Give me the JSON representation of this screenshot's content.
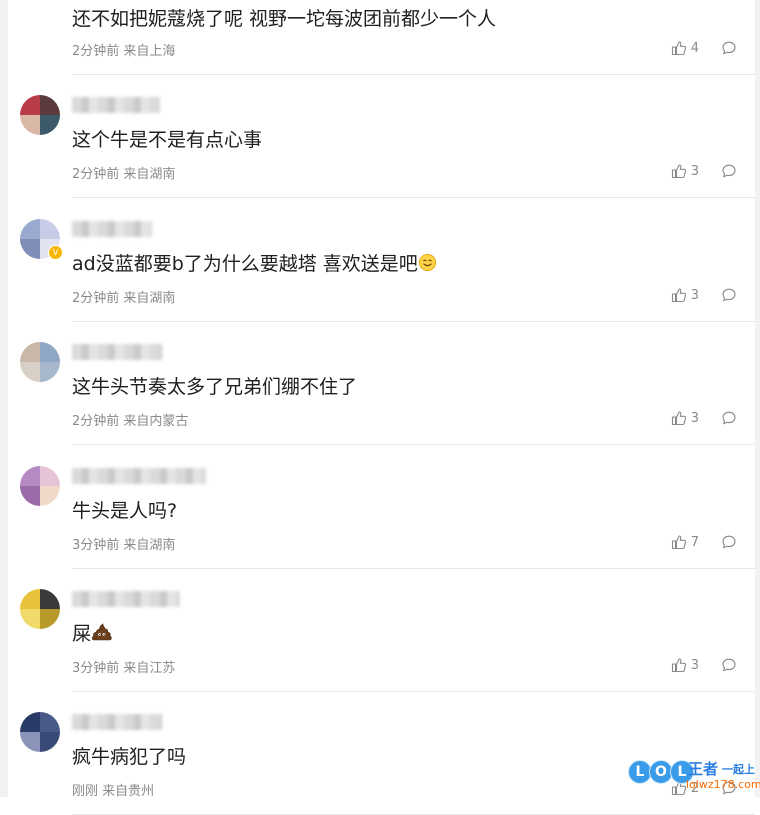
{
  "comments": [
    {
      "text": "还不如把妮蔻烧了呢 视野一坨每波团前都少一个人",
      "time": "2分钟前",
      "location": "来自上海",
      "likes": "4",
      "avatar_colors": [
        "#3a3a3a",
        "#6a6a6a",
        "#8a8a8a",
        "#4a4a4a"
      ]
    },
    {
      "text": "这个牛是不是有点心事",
      "time": "2分钟前",
      "location": "来自湖南",
      "likes": "3",
      "avatar_colors": [
        "#b83c4a",
        "#5a3a3a",
        "#d9b8a8",
        "#3c5a6a"
      ]
    },
    {
      "text": "ad没蓝都要b了为什么要越塔 喜欢送是吧",
      "emoji": "smile-emoji",
      "time": "2分钟前",
      "location": "来自湖南",
      "likes": "3",
      "avatar_colors": [
        "#9aa9cf",
        "#c7cde6",
        "#7f8db8",
        "#e1e4f0"
      ],
      "verified": true
    },
    {
      "text": "这牛头节奏太多了兄弟们绷不住了",
      "time": "2分钟前",
      "location": "来自内蒙古",
      "likes": "3",
      "avatar_colors": [
        "#c9b7a8",
        "#8fa6c4",
        "#d8cfc6",
        "#a8b8cc"
      ]
    },
    {
      "text": "牛头是人吗?",
      "time": "3分钟前",
      "location": "来自湖南",
      "likes": "7",
      "avatar_colors": [
        "#b58ac2",
        "#e6c4d8",
        "#9c6aa8",
        "#f0d9c8"
      ]
    },
    {
      "text": "屎",
      "emoji": "poop-emoji",
      "time": "3分钟前",
      "location": "来自江苏",
      "likes": "3",
      "avatar_colors": [
        "#e7c23a",
        "#3a3a3a",
        "#f1d96a",
        "#b89a2a"
      ]
    },
    {
      "text": "疯牛病犯了吗",
      "time": "刚刚",
      "location": "来自贵州",
      "likes": "2",
      "avatar_colors": [
        "#2a3a66",
        "#4a5a88",
        "#8a94b8",
        "#3a4a78"
      ]
    }
  ],
  "watermark": {
    "logo_text": "LOL",
    "brand": "王者",
    "slogan": "一起上",
    "url": "lolwz178.com"
  },
  "colors": {
    "text": "#202020",
    "meta": "#8a8a8a",
    "divider": "#e7e7e7"
  }
}
